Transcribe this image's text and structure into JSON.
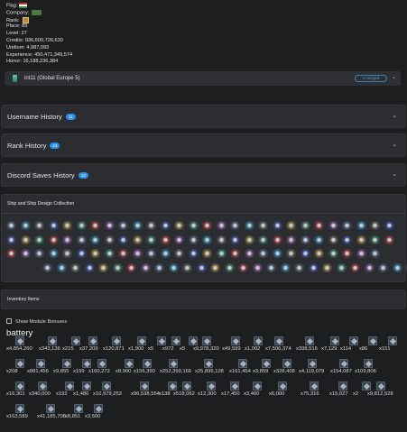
{
  "profile": {
    "flag_label": "Flag:",
    "company_label": "Company:",
    "rank_label": "Rank:",
    "place": "Place: 89",
    "level": "Level: 27",
    "credits": "Credits: 936,609,726,630",
    "uridium": "Uridium: 4,987,093",
    "experience": "Experience: 450,471,349,574",
    "honor": "Honor: 16,188,236,384"
  },
  "server": {
    "name": "int11 (Global Europe 5)",
    "badge": "1 merged"
  },
  "sections": {
    "username_history": {
      "title": "Username History",
      "count": "11"
    },
    "rank_history": {
      "title": "Rank History",
      "count": "24"
    },
    "discord_saves": {
      "title": "Discord Saves History",
      "count": "10"
    },
    "ship_collection": {
      "title": "Ship and Ship Design Collection"
    },
    "inventory": {
      "title": "Inventory Items"
    }
  },
  "inventory": {
    "module_bonuses_label": "Show Module Bonuses",
    "category": "battery",
    "rows": [
      [
        "x4,854,260",
        "x343,136",
        "x215",
        "x37,209",
        "x120,871",
        "x1,900",
        "x5",
        "x972",
        "x5",
        "x9,978,320",
        "x49,599",
        "x1,002",
        "x7,506,374",
        "x398,516",
        "x7,129",
        "x114",
        "x86",
        "x151"
      ],
      [
        "x208",
        "x881,456",
        "x9,855",
        "x199",
        "x160,272",
        "x8,900",
        "x156,390",
        "x252,350,166",
        "x25,896,128",
        "x161,454",
        "x3,859",
        "x328,408",
        "x4,119,079",
        "x154,087",
        "x109,806"
      ],
      [
        "x16,301",
        "x340,000",
        "x192",
        "x1,486",
        "x10,979,253",
        "x96,538,554",
        "x138",
        "x518,062",
        "x12,300",
        "x17,450",
        "x3,460",
        "x6,000",
        "x75,316",
        "x15,027",
        "x2",
        "x9,812,528"
      ],
      [
        "x163,589",
        "x41,185,708",
        "x8,851",
        "x3,500"
      ]
    ]
  },
  "colors": {
    "accent": "#2b8ee6",
    "panel": "#2c2d30",
    "background": "#1d1e20"
  }
}
